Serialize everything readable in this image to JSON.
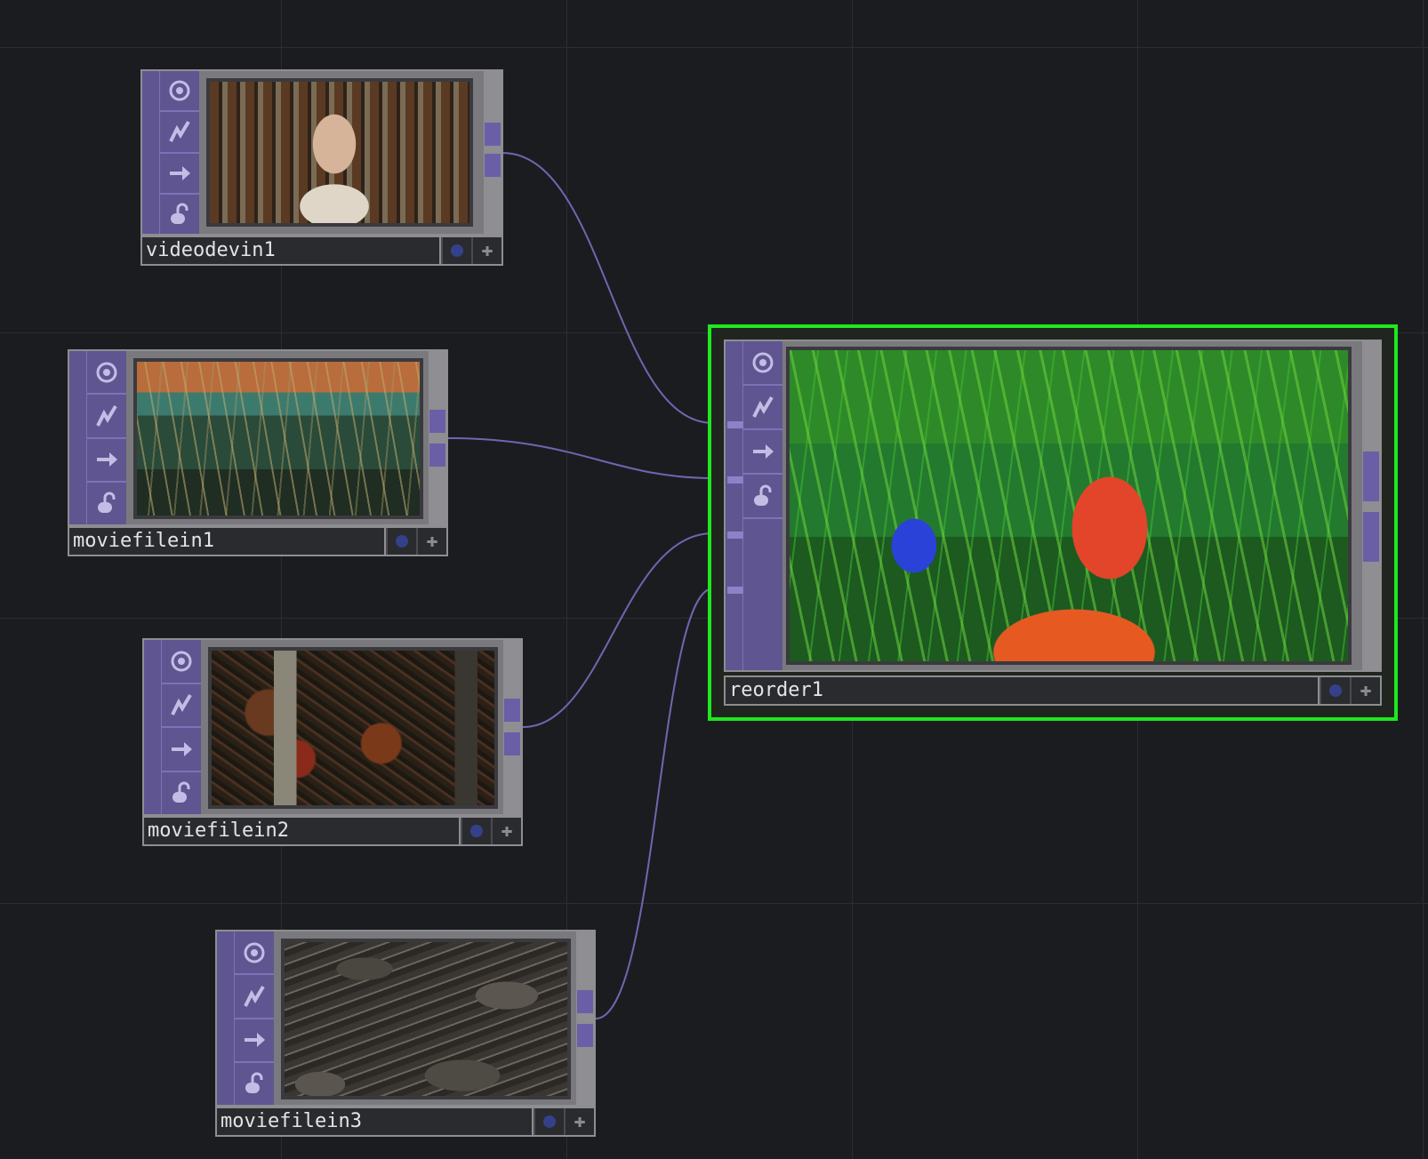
{
  "network": {
    "nodes": [
      {
        "name": "videodevin1",
        "thumbnail": "webcam-image"
      },
      {
        "name": "moviefilein1",
        "thumbnail": "grass-image"
      },
      {
        "name": "moviefilein2",
        "thumbnail": "forest-image"
      },
      {
        "name": "moviefilein3",
        "thumbnail": "rocks-image"
      },
      {
        "name": "reorder1",
        "thumbnail": "composite-image",
        "selected": true
      }
    ],
    "connections": [
      {
        "from": "videodevin1",
        "to": "reorder1"
      },
      {
        "from": "moviefilein1",
        "to": "reorder1"
      },
      {
        "from": "moviefilein2",
        "to": "reorder1"
      },
      {
        "from": "moviefilein3",
        "to": "reorder1"
      }
    ]
  },
  "colors": {
    "background": "#1b1c20",
    "operator_accent": "#5f5590",
    "wire": "#6f66b0",
    "selection": "#1ee81e",
    "viewer_dot": "#34418a"
  },
  "icons": [
    "viewer-icon",
    "bypass-icon",
    "display-icon",
    "lock-icon",
    "viewer-toggle-icon",
    "plus-icon"
  ]
}
